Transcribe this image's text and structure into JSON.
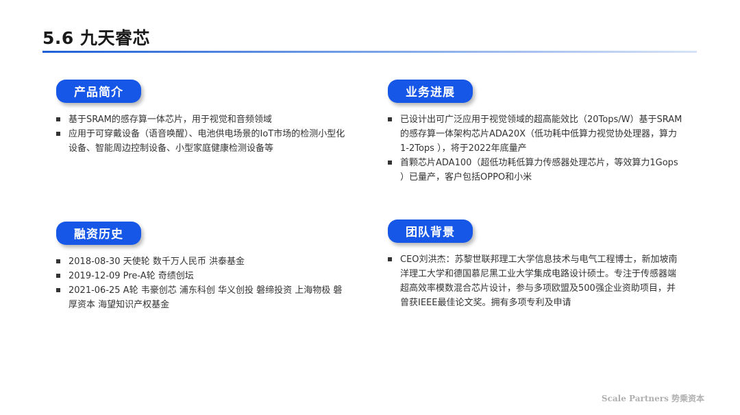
{
  "title": "5.6 九天睿芯",
  "sections": {
    "product": {
      "heading": "产品简介",
      "items": [
        "基于SRAM的感存算一体芯片，用于视觉和音频领域",
        "应用于可穿戴设备（语音唤醒）、电池供电场景的IoT市场的检测小型化设备、智能周边控制设备、小型家庭健康检测设备等"
      ]
    },
    "business": {
      "heading": "业务进展",
      "items": [
        "已设计出可广泛应用于视觉领域的超高能效比（20Tops/W）基于SRAM的感存算一体架构芯片ADA20X（低功耗中低算力视觉协处理器，算力1-2Tops ），将于2022年底量产",
        "首颗芯片ADA100（超低功耗低算力传感器处理芯片，等效算力1Gops ）已量产，客户包括OPPO和小米"
      ]
    },
    "financing": {
      "heading": "融资历史",
      "items": [
        "2018-08-30 天使轮 数千万人民币 洪泰基金",
        "2019-12-09 Pre-A轮 奇绩创坛",
        "2021-06-25 A轮 韦豪创芯 浦东科创 华义创投 磐缔投资 上海物极 磐厚资本 海望知识产权基金"
      ]
    },
    "team": {
      "heading": "团队背景",
      "items": [
        "CEO刘洪杰：苏黎世联邦理工大学信息技术与电气工程博士，新加坡南洋理工大学和德国慕尼黑工业大学集成电路设计硕士。专注于传感器端超高效率模数混合芯片设计，参与多项欧盟及500强企业资助项目，并曾获IEEE最佳论文奖。拥有多项专利及申请"
      ]
    }
  },
  "footer": {
    "watermark": "Scale Partners 势乘资本"
  },
  "colors": {
    "accent": "#1657e8",
    "text": "#333333"
  }
}
